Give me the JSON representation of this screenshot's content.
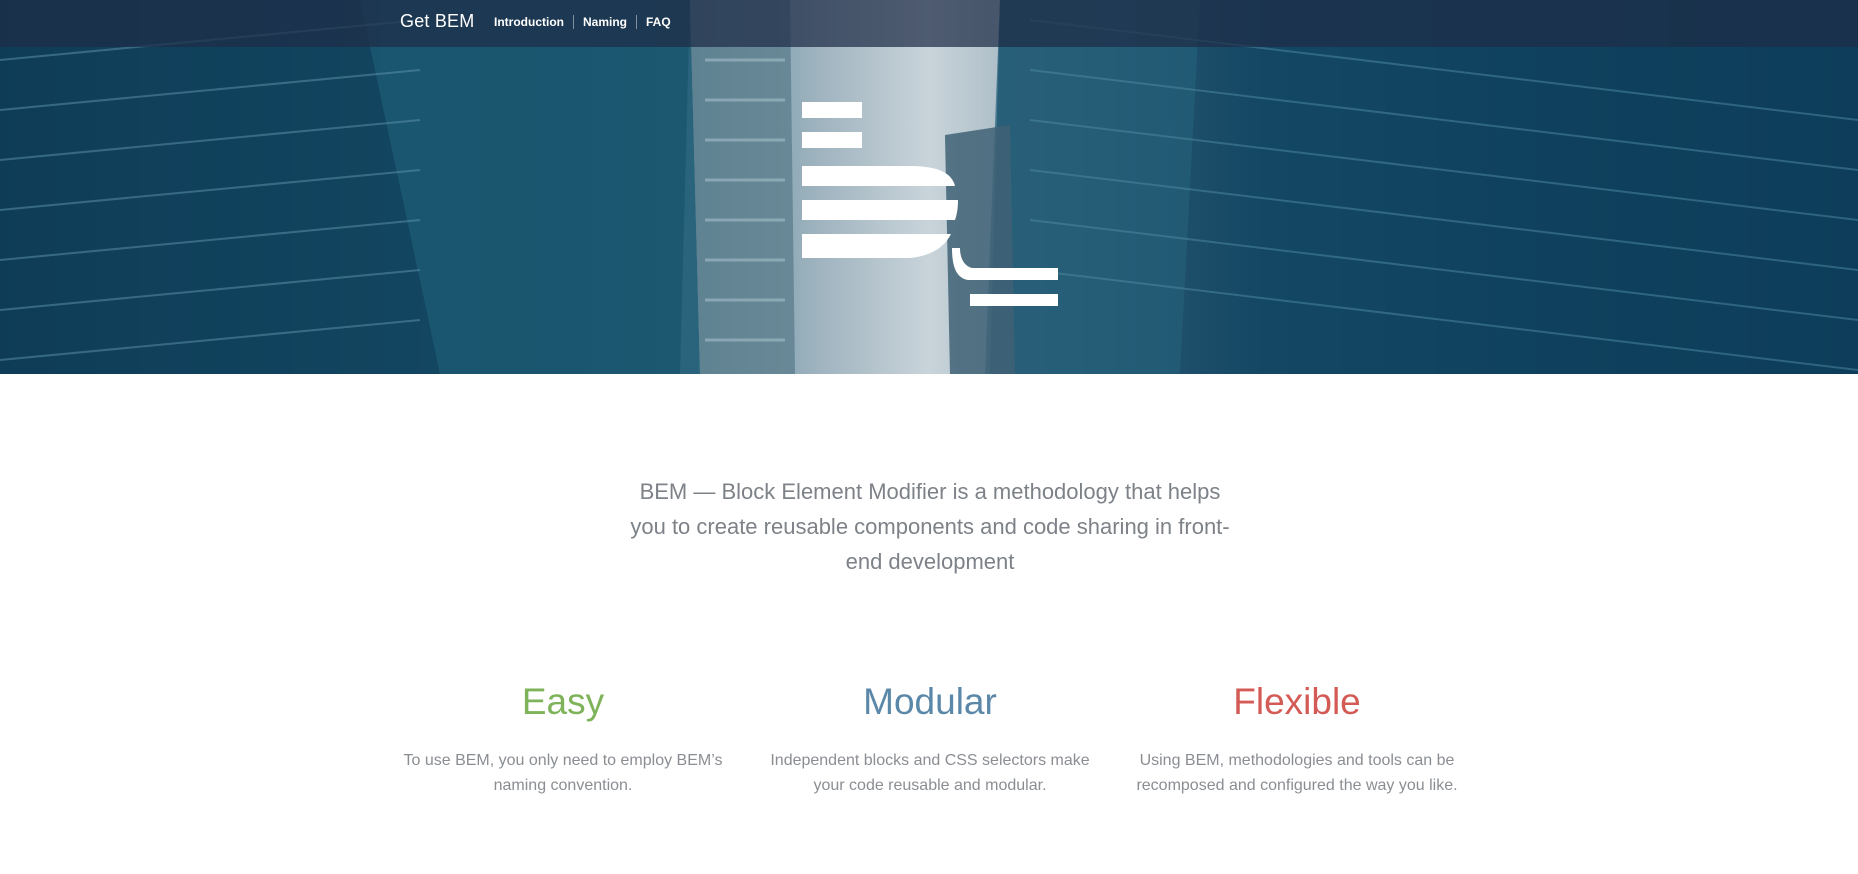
{
  "header": {
    "brand": "Get BEM",
    "nav": [
      {
        "label": "Introduction"
      },
      {
        "label": "Naming"
      },
      {
        "label": "FAQ"
      }
    ]
  },
  "intro": {
    "text": "BEM — Block Element Modifier is a methodology that helps you to create reusable components and code sharing in front-end development"
  },
  "features": [
    {
      "title": "Easy",
      "text": "To use BEM, you only need to employ BEM’s naming convention.",
      "color": "#7eb35a"
    },
    {
      "title": "Modular",
      "text": "Independent blocks and CSS selectors make your code reusable and modular.",
      "color": "#5b88a8"
    },
    {
      "title": "Flexible",
      "text": "Using BEM, methodologies and tools can be recomposed and configured the way you like.",
      "color": "#d35a55"
    }
  ]
}
